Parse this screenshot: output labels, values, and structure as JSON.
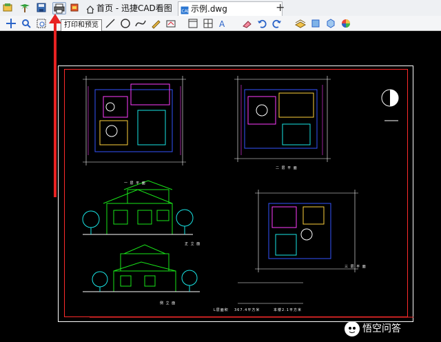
{
  "window": {
    "tabs": [
      {
        "label": "首页 - 迅捷CAD看图",
        "icon": "home-icon"
      },
      {
        "label": "示例.dwg",
        "icon": "dwg-file-icon"
      }
    ],
    "new_tab_label": "+"
  },
  "toolbar": {
    "tooltip": "打印和预览"
  },
  "drawing": {
    "labels": {
      "plan_1": "一 层 平 面",
      "plan_2": "二 层 平 面",
      "plan_3": "三 层 平 面",
      "elev_front": "正 立 面",
      "elev_side": "侧 立 面",
      "area_1": "L层面积",
      "area_2": "367.4平方米",
      "area_3": "本楼2.1平方米"
    }
  },
  "watermark": {
    "text": "悟空问答"
  },
  "colors": {
    "canvas_bg": "#000000",
    "frame": "#ffffff",
    "inner_frame": "#ff2b2b",
    "arrow": "#e82222",
    "elevation_green": "#19e619",
    "dim_white": "#ffffff",
    "wall_magenta": "#ff3cff",
    "wall_blue": "#3355ff"
  }
}
